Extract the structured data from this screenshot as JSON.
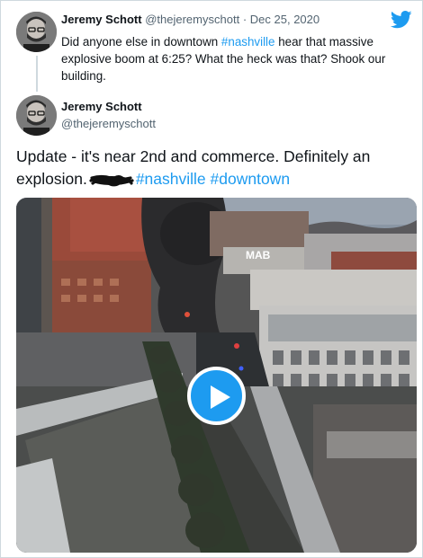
{
  "tweet1": {
    "author_name": "Jeremy Schott",
    "author_handle": "@thejeremyschott",
    "separator": "·",
    "date": "Dec 25, 2020",
    "text_before": "Did anyone else in downtown ",
    "hashtag": "#nashville",
    "text_after": " hear that massive explosive boom at 6:25? What the heck was that? Shook our building."
  },
  "tweet2": {
    "author_name": "Jeremy Schott",
    "author_handle": "@thejeremyschott",
    "text": "Update - it's near 2nd and commerce. Definitely an explosion.",
    "hashtags": [
      "#nashville",
      "#downtown"
    ],
    "media": {
      "type": "video",
      "play_icon": "play-icon",
      "building_sign": "MAB"
    }
  },
  "icons": {
    "brand": "twitter-bird-icon"
  },
  "colors": {
    "accent": "#1d9bf0",
    "text": "#0f1419",
    "muted": "#536471"
  }
}
